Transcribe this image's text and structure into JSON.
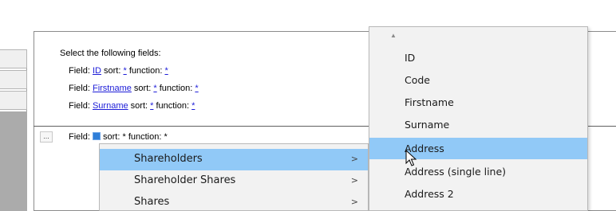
{
  "editor": {
    "header": "Select the following fields:",
    "rows": [
      {
        "prefix": "Field: ",
        "field": "ID",
        "sort_label": " sort: ",
        "sort": "*",
        "func_label": " function: ",
        "func": "*"
      },
      {
        "prefix": "Field: ",
        "field": "Firstname",
        "sort_label": " sort: ",
        "sort": "*",
        "func_label": " function: ",
        "func": "*"
      },
      {
        "prefix": "Field: ",
        "field": "Surname",
        "sort_label": " sort: ",
        "sort": "*",
        "func_label": " function: ",
        "func": "*"
      }
    ],
    "active_row": {
      "dots": "...",
      "prefix": "Field: ",
      "sort_label": " sort: ",
      "sort": "*",
      "func_label": " function: ",
      "func": "*"
    }
  },
  "table_menu": {
    "items": [
      {
        "label": "Shareholders",
        "arrow": ">"
      },
      {
        "label": "Shareholder Shares",
        "arrow": ">"
      },
      {
        "label": "Shares",
        "arrow": ">"
      }
    ],
    "highlighted": "Shareholders"
  },
  "field_menu": {
    "scroll_up": "▲",
    "items": [
      "ID",
      "Code",
      "Firstname",
      "Surname",
      "Address",
      "Address (single line)",
      "Address 2"
    ],
    "highlighted": "Address"
  },
  "colors": {
    "highlight": "#91c9f7",
    "link": "#1c1cd8",
    "menu_bg": "#f2f2f2"
  }
}
